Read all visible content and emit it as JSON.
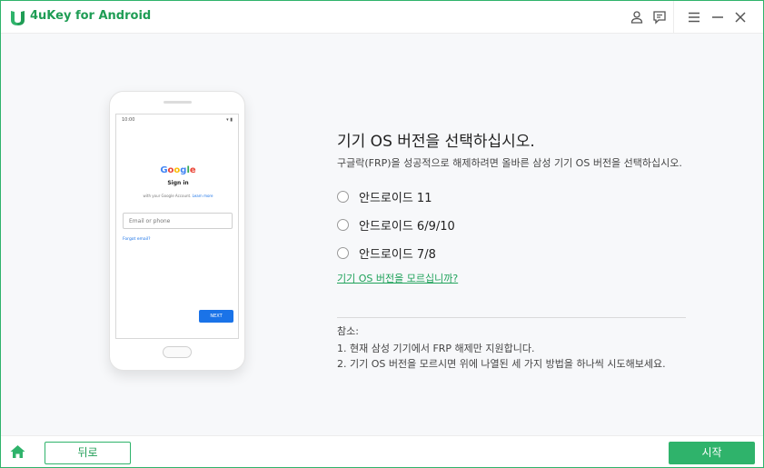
{
  "app": {
    "title": "4uKey for Android",
    "brand_color": "#2fb36b",
    "logo_icon": "4ukey-logo-icon"
  },
  "titlebar": {
    "icons": [
      "user-icon",
      "feedback-icon",
      "menu-icon",
      "minimize-icon",
      "close-icon"
    ]
  },
  "phone": {
    "time": "10:00",
    "status": "▾ ▮",
    "google_letters": [
      "G",
      "o",
      "o",
      "g",
      "l",
      "e"
    ],
    "sign_in": "Sign in",
    "with_account": "with your Google Account.",
    "learn_more": "Learn more",
    "email_placeholder": "Email or phone",
    "forgot_email": "Forgot email?",
    "next": "NEXT"
  },
  "main": {
    "heading": "기기 OS 버전을 선택하십시오.",
    "subtitle": "구글락(FRP)을 성공적으로 해제하려면 올바른 삼성 기기 OS 버전을 선택하십시오.",
    "options": [
      {
        "label": "안드로이드 11",
        "selected": false
      },
      {
        "label": "안드로이드 6/9/10",
        "selected": false
      },
      {
        "label": "안드로이드 7/8",
        "selected": false
      }
    ],
    "help_link": "기기 OS 버전을 모르십니까?",
    "note_title": "참소:",
    "notes": [
      "1. 현재 삼성 기기에서 FRP 해제만 지원합니다.",
      "2. 기기 OS 버전을 모르시면 위에 나열된 세 가지 방법을 하나씩 시도해보세요."
    ]
  },
  "footer": {
    "home_icon": "home-icon",
    "back_label": "뒤로",
    "start_label": "시작"
  }
}
